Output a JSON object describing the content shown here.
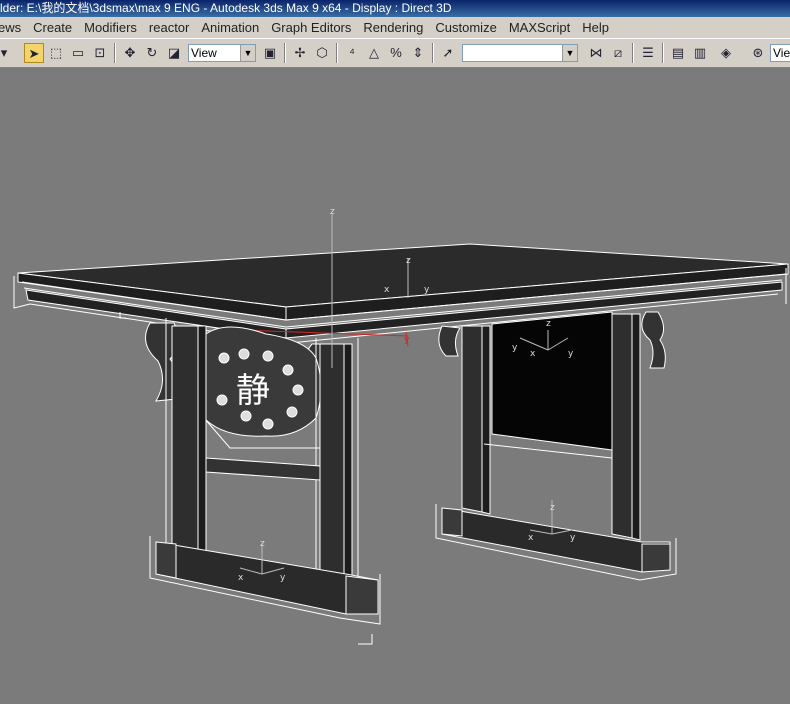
{
  "window": {
    "title": "lder: E:\\我的文档\\3dsmax\\max 9 ENG      - Autodesk 3ds Max 9 x64       - Display : Direct 3D"
  },
  "menu": {
    "items": [
      "ews",
      "Create",
      "Modifiers",
      "reactor",
      "Animation",
      "Graph Editors",
      "Rendering",
      "Customize",
      "MAXScript",
      "Help"
    ]
  },
  "toolbar": {
    "reference_coord": "View",
    "named_selection": "",
    "right_view": "Vie"
  },
  "viewport": {
    "axis_labels": {
      "x": "x",
      "y": "y",
      "z": "z"
    },
    "carving_text": "静"
  },
  "colors": {
    "viewport_bg": "#7b7b7b",
    "wire_white": "#ffffff",
    "selection_red": "#cc2a2a",
    "active_tool": "#f3d46b"
  }
}
